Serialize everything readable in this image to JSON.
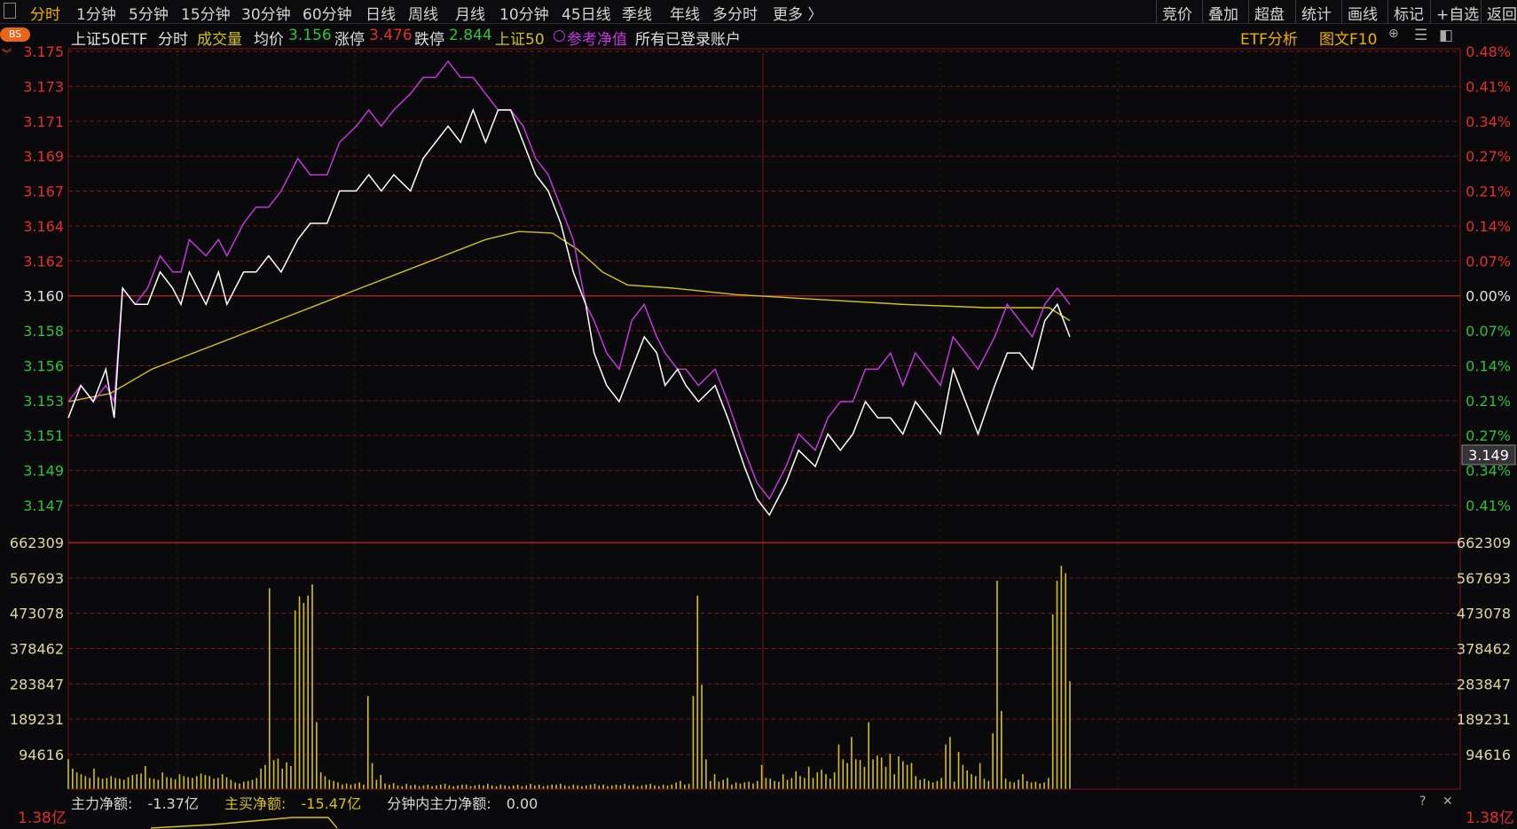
{
  "toolbar": {
    "periods": [
      "分时",
      "1分钟",
      "5分钟",
      "15分钟",
      "30分钟",
      "60分钟",
      "日线",
      "周线",
      "月线",
      "10分钟",
      "45日线",
      "季线",
      "年线",
      "多分时",
      "更多 〉"
    ],
    "active_index": 0,
    "right_buttons": [
      "竞价",
      "叠加",
      "超盘",
      "统计",
      "画线",
      "标记",
      "+自选",
      "返回"
    ]
  },
  "info": {
    "bs_badge": "BS",
    "name": "上证50ETF",
    "mode": "分时",
    "indicator": "成交量",
    "avg_label": "均价",
    "avg_value": "3.156",
    "limit_up_label": "涨停",
    "limit_up_value": "3.476",
    "limit_down_label": "跌停",
    "limit_down_value": "2.844",
    "index_name": "上证50",
    "nav_label": "参考净值",
    "account_label": "所有已登录账户",
    "etf_analysis": "ETF分析",
    "f10": "图文F10"
  },
  "colors": {
    "price_line": "#ffffff",
    "nav_line": "#c03ad8",
    "avg_line": "#d4c020",
    "volume_bar": "#d4c020",
    "up": "#e03030",
    "down": "#30c040",
    "grid": "#7a1515",
    "accent": "#f0b000"
  },
  "chart_data": {
    "type": "line",
    "price_axis": {
      "labels": [
        "3.175",
        "3.173",
        "3.171",
        "3.169",
        "3.167",
        "3.164",
        "3.162",
        "3.160",
        "3.158",
        "3.156",
        "3.153",
        "3.151",
        "3.149",
        "3.147"
      ],
      "pct_labels": [
        "0.48%",
        "0.41%",
        "0.34%",
        "0.27%",
        "0.21%",
        "0.14%",
        "0.07%",
        "0.00%",
        "0.07%",
        "0.14%",
        "0.21%",
        "0.27%",
        "0.34%",
        "0.41%"
      ],
      "prev_close": 3.16,
      "ylim": [
        3.1453,
        3.1755
      ]
    },
    "current_price_label": "3.149",
    "volume_axis": {
      "labels": [
        "662309",
        "567693",
        "473078",
        "378462",
        "283847",
        "189231",
        "94616"
      ],
      "ylim": [
        0,
        662309
      ]
    },
    "x_range": [
      0,
      240
    ],
    "series": [
      {
        "key": "price",
        "points": [
          [
            0,
            3.153
          ],
          [
            3,
            3.155
          ],
          [
            6,
            3.154
          ],
          [
            9,
            3.156
          ],
          [
            11,
            3.153
          ],
          [
            13,
            3.161
          ],
          [
            16,
            3.16
          ],
          [
            19,
            3.16
          ],
          [
            22,
            3.162
          ],
          [
            25,
            3.161
          ],
          [
            27,
            3.16
          ],
          [
            29,
            3.162
          ],
          [
            33,
            3.16
          ],
          [
            36,
            3.162
          ],
          [
            38,
            3.16
          ],
          [
            42,
            3.162
          ],
          [
            45,
            3.162
          ],
          [
            48,
            3.163
          ],
          [
            51,
            3.162
          ],
          [
            55,
            3.164
          ],
          [
            58,
            3.165
          ],
          [
            62,
            3.165
          ],
          [
            65,
            3.167
          ],
          [
            69,
            3.167
          ],
          [
            72,
            3.168
          ],
          [
            75,
            3.167
          ],
          [
            78,
            3.168
          ],
          [
            82,
            3.167
          ],
          [
            85,
            3.169
          ],
          [
            88,
            3.17
          ],
          [
            91,
            3.171
          ],
          [
            94,
            3.17
          ],
          [
            97,
            3.172
          ],
          [
            100,
            3.17
          ],
          [
            103,
            3.172
          ],
          [
            106,
            3.172
          ],
          [
            109,
            3.17
          ],
          [
            112,
            3.168
          ],
          [
            115,
            3.167
          ],
          [
            118,
            3.165
          ],
          [
            121,
            3.162
          ],
          [
            124,
            3.16
          ],
          [
            126,
            3.157
          ],
          [
            129,
            3.155
          ],
          [
            132,
            3.154
          ],
          [
            135,
            3.156
          ],
          [
            138,
            3.158
          ],
          [
            141,
            3.157
          ],
          [
            143,
            3.155
          ],
          [
            146,
            3.156
          ],
          [
            148,
            3.155
          ],
          [
            151,
            3.154
          ],
          [
            155,
            3.155
          ],
          [
            158,
            3.153
          ],
          [
            162,
            3.15
          ],
          [
            165,
            3.148
          ],
          [
            168,
            3.147
          ],
          [
            172,
            3.149
          ],
          [
            175,
            3.151
          ],
          [
            179,
            3.15
          ],
          [
            182,
            3.152
          ],
          [
            185,
            3.151
          ],
          [
            188,
            3.152
          ],
          [
            191,
            3.154
          ],
          [
            194,
            3.153
          ],
          [
            197,
            3.153
          ],
          [
            200,
            3.152
          ],
          [
            203,
            3.154
          ],
          [
            206,
            3.153
          ],
          [
            209,
            3.152
          ],
          [
            212,
            3.156
          ],
          [
            215,
            3.154
          ],
          [
            218,
            3.152
          ],
          [
            222,
            3.155
          ],
          [
            225,
            3.157
          ],
          [
            228,
            3.157
          ],
          [
            231,
            3.156
          ],
          [
            234,
            3.159
          ],
          [
            237,
            3.16
          ],
          [
            240,
            3.158
          ]
        ]
      },
      {
        "key": "nav",
        "points": [
          [
            0,
            3.154
          ],
          [
            3,
            3.155
          ],
          [
            6,
            3.154
          ],
          [
            9,
            3.155
          ],
          [
            11,
            3.154
          ],
          [
            13,
            3.161
          ],
          [
            16,
            3.16
          ],
          [
            19,
            3.161
          ],
          [
            22,
            3.163
          ],
          [
            25,
            3.162
          ],
          [
            27,
            3.162
          ],
          [
            29,
            3.164
          ],
          [
            33,
            3.163
          ],
          [
            36,
            3.164
          ],
          [
            38,
            3.163
          ],
          [
            42,
            3.165
          ],
          [
            45,
            3.166
          ],
          [
            48,
            3.166
          ],
          [
            51,
            3.167
          ],
          [
            55,
            3.169
          ],
          [
            58,
            3.168
          ],
          [
            62,
            3.168
          ],
          [
            65,
            3.17
          ],
          [
            69,
            3.171
          ],
          [
            72,
            3.172
          ],
          [
            75,
            3.171
          ],
          [
            78,
            3.172
          ],
          [
            82,
            3.173
          ],
          [
            85,
            3.174
          ],
          [
            88,
            3.174
          ],
          [
            91,
            3.175
          ],
          [
            94,
            3.174
          ],
          [
            97,
            3.174
          ],
          [
            100,
            3.173
          ],
          [
            103,
            3.172
          ],
          [
            106,
            3.172
          ],
          [
            109,
            3.171
          ],
          [
            112,
            3.169
          ],
          [
            115,
            3.168
          ],
          [
            118,
            3.166
          ],
          [
            121,
            3.164
          ],
          [
            124,
            3.16
          ],
          [
            126,
            3.159
          ],
          [
            129,
            3.157
          ],
          [
            132,
            3.156
          ],
          [
            135,
            3.159
          ],
          [
            138,
            3.16
          ],
          [
            141,
            3.158
          ],
          [
            143,
            3.157
          ],
          [
            146,
            3.156
          ],
          [
            148,
            3.156
          ],
          [
            151,
            3.155
          ],
          [
            155,
            3.156
          ],
          [
            158,
            3.154
          ],
          [
            162,
            3.151
          ],
          [
            165,
            3.149
          ],
          [
            168,
            3.148
          ],
          [
            172,
            3.15
          ],
          [
            175,
            3.152
          ],
          [
            179,
            3.151
          ],
          [
            182,
            3.153
          ],
          [
            185,
            3.154
          ],
          [
            188,
            3.154
          ],
          [
            191,
            3.156
          ],
          [
            194,
            3.156
          ],
          [
            197,
            3.157
          ],
          [
            200,
            3.155
          ],
          [
            203,
            3.157
          ],
          [
            206,
            3.156
          ],
          [
            209,
            3.155
          ],
          [
            212,
            3.158
          ],
          [
            215,
            3.157
          ],
          [
            218,
            3.156
          ],
          [
            222,
            3.158
          ],
          [
            225,
            3.16
          ],
          [
            228,
            3.159
          ],
          [
            231,
            3.158
          ],
          [
            234,
            3.16
          ],
          [
            237,
            3.161
          ],
          [
            240,
            3.16
          ]
        ]
      },
      {
        "key": "avg",
        "points": [
          [
            0,
            3.154
          ],
          [
            10,
            3.1545
          ],
          [
            20,
            3.156
          ],
          [
            30,
            3.157
          ],
          [
            40,
            3.158
          ],
          [
            50,
            3.159
          ],
          [
            60,
            3.16
          ],
          [
            70,
            3.161
          ],
          [
            80,
            3.162
          ],
          [
            90,
            3.163
          ],
          [
            100,
            3.164
          ],
          [
            108,
            3.1645
          ],
          [
            116,
            3.1644
          ],
          [
            122,
            3.1634
          ],
          [
            128,
            3.162
          ],
          [
            134,
            3.1612
          ],
          [
            145,
            3.161
          ],
          [
            160,
            3.1606
          ],
          [
            180,
            3.1603
          ],
          [
            200,
            3.16
          ],
          [
            220,
            3.1598
          ],
          [
            235,
            3.1598
          ],
          [
            240,
            3.159
          ]
        ]
      }
    ],
    "volumes": [
      80000,
      55000,
      45000,
      40000,
      35000,
      30000,
      55000,
      32000,
      28000,
      30000,
      35000,
      30000,
      28000,
      25000,
      32000,
      38000,
      40000,
      42000,
      62000,
      30000,
      28000,
      25000,
      45000,
      32000,
      30000,
      26000,
      40000,
      35000,
      32000,
      30000,
      35000,
      42000,
      38000,
      35000,
      28000,
      30000,
      40000,
      32000,
      25000,
      18000,
      15000,
      20000,
      22000,
      25000,
      30000,
      55000,
      65000,
      540000,
      78000,
      82000,
      55000,
      72000,
      62000,
      480000,
      518000,
      500000,
      520000,
      550000,
      180000,
      45000,
      35000,
      25000,
      22000,
      18000,
      12000,
      15000,
      12000,
      15000,
      18000,
      12000,
      250000,
      70000,
      25000,
      38000,
      15000,
      12000,
      16000,
      10000,
      8000,
      14000,
      10000,
      12000,
      8000,
      10000,
      12000,
      8000,
      10000,
      12000,
      14000,
      10000,
      8000,
      10000,
      12000,
      12000,
      8000,
      10000,
      12000,
      10000,
      14000,
      10000,
      8000,
      12000,
      10000,
      8000,
      10000,
      12000,
      8000,
      10000,
      14000,
      10000,
      12000,
      8000,
      10000,
      12000,
      12000,
      14000,
      10000,
      8000,
      12000,
      10000,
      8000,
      10000,
      12000,
      14000,
      10000,
      12000,
      8000,
      10000,
      12000,
      10000,
      14000,
      10000,
      12000,
      8000,
      10000,
      12000,
      14000,
      10000,
      8000,
      12000,
      10000,
      12000,
      18000,
      22000,
      12000,
      14000,
      250000,
      520000,
      280000,
      80000,
      22000,
      40000,
      20000,
      25000,
      30000,
      12000,
      18000,
      15000,
      18000,
      20000,
      15000,
      22000,
      65000,
      30000,
      28000,
      22000,
      20000,
      40000,
      25000,
      30000,
      48000,
      35000,
      30000,
      60000,
      30000,
      45000,
      52000,
      40000,
      28000,
      45000,
      120000,
      80000,
      70000,
      140000,
      80000,
      78000,
      60000,
      180000,
      80000,
      90000,
      85000,
      60000,
      95000,
      40000,
      88000,
      75000,
      65000,
      70000,
      35000,
      25000,
      28000,
      22000,
      18000,
      22000,
      30000,
      120000,
      140000,
      20000,
      100000,
      65000,
      50000,
      40000,
      35000,
      70000,
      28000,
      22000,
      150000,
      560000,
      210000,
      28000,
      20000,
      18000,
      25000,
      40000,
      22000,
      18000,
      20000,
      15000,
      18000,
      30000,
      470000,
      560000,
      600000,
      580000,
      290000
    ]
  },
  "status": {
    "main_net_label": "主力净额:",
    "main_net_value": "-1.37亿",
    "main_buy_label": "主买净额:",
    "main_buy_value": "-15.47亿",
    "minute_net_label": "分钟内主力净额:",
    "minute_net_value": "0.00",
    "bottom_axis_label": "1.38亿"
  }
}
